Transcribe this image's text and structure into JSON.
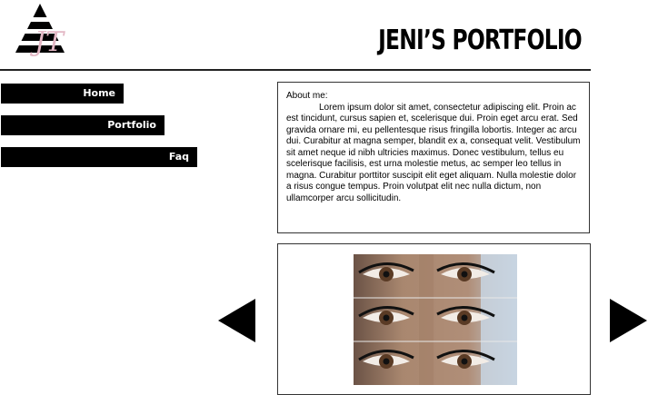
{
  "header": {
    "title": "JENI’S PORTFOLIO",
    "logo_icon": "triangle-logo-with-monogram"
  },
  "nav": {
    "items": [
      {
        "label": "Home"
      },
      {
        "label": "Portfolio"
      },
      {
        "label": "Faq"
      }
    ]
  },
  "about": {
    "heading": "About me:",
    "body": "Lorem ipsum dolor sit amet, consectetur adipiscing elit. Proin ac est tincidunt, cursus sapien et, scelerisque dui. Proin eget arcu erat. Sed gravida ornare mi, eu pellentesque risus fringilla lobortis. Integer ac arcu dui. Curabitur at magna semper, blandit ex a, consequat velit. Vestibulum sit amet neque id nibh ultricies maximus. Donec vestibulum, tellus eu scelerisque facilisis, est urna molestie metus, ac semper leo tellus in magna. Curabitur porttitor suscipit elit eget aliquam. Nulla molestie dolor a risus congue tempus. Proin volutpat elit nec nulla dictum, non ullamcorper arcu sollicitudin."
  },
  "gallery": {
    "prev_icon": "triangle-left-icon",
    "next_icon": "triangle-right-icon",
    "image_icon": "eyelash-extension-photo"
  },
  "colors": {
    "nav_bg": "#000000",
    "nav_text": "#ffffff",
    "monogram": "#e3b7c4",
    "rule": "#222222"
  }
}
